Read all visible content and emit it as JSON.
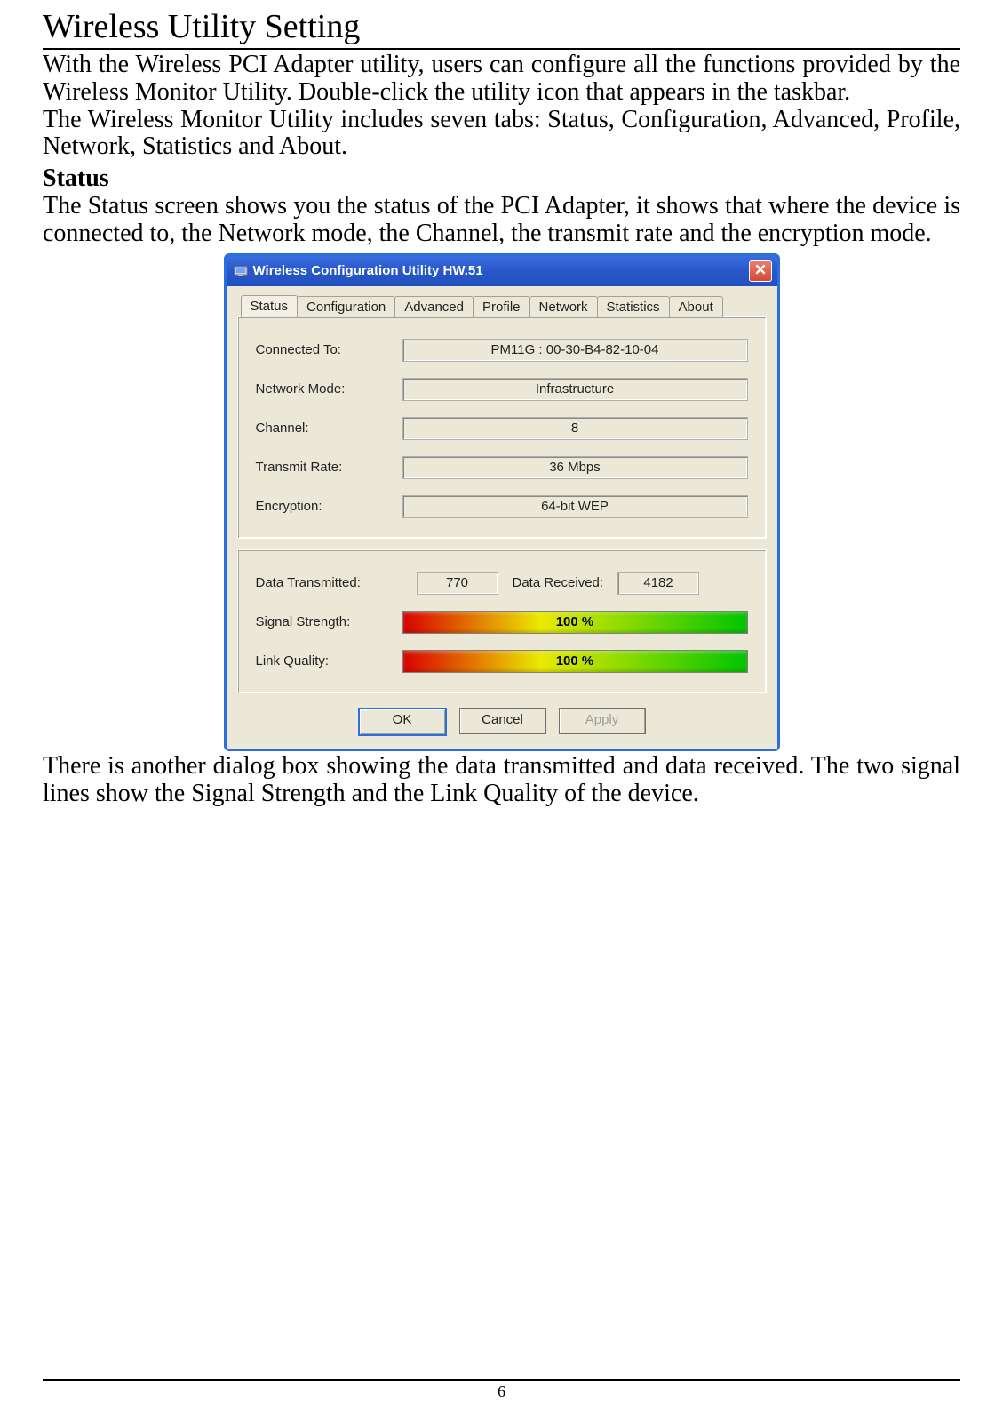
{
  "doc": {
    "heading": "Wireless Utility Setting",
    "para1": "With the Wireless PCI Adapter utility, users can configure all the functions provided by the Wireless Monitor Utility. Double-click the utility icon that appears in the taskbar.",
    "para2": "The Wireless Monitor Utility includes seven tabs: Status, Configuration, Advanced, Profile, Network, Statistics and About.",
    "subheading": "Status",
    "para3": "The Status screen shows you the status of the PCI Adapter, it shows that where the device is connected to, the Network mode, the Channel, the transmit rate and the encryption mode.",
    "para4": "There is another dialog box showing the data transmitted and data received. The two signal lines show the Signal Strength and the Link Quality of the device.",
    "page_number": "6"
  },
  "dialog": {
    "title": "Wireless Configuration Utility HW.51",
    "tabs": [
      "Status",
      "Configuration",
      "Advanced",
      "Profile",
      "Network",
      "Statistics",
      "About"
    ],
    "fields": {
      "connected_to_label": "Connected To:",
      "connected_to_value": "PM11G : 00-30-B4-82-10-04",
      "network_mode_label": "Network Mode:",
      "network_mode_value": "Infrastructure",
      "channel_label": "Channel:",
      "channel_value": "8",
      "transmit_rate_label": "Transmit Rate:",
      "transmit_rate_value": "36 Mbps",
      "encryption_label": "Encryption:",
      "encryption_value": "64-bit WEP"
    },
    "data": {
      "data_tx_label": "Data Transmitted:",
      "data_tx_value": "770",
      "data_rx_label": "Data Received:",
      "data_rx_value": "4182",
      "signal_label": "Signal Strength:",
      "signal_value": "100 %",
      "link_label": "Link Quality:",
      "link_value": "100 %"
    },
    "buttons": {
      "ok": "OK",
      "cancel": "Cancel",
      "apply": "Apply"
    }
  }
}
